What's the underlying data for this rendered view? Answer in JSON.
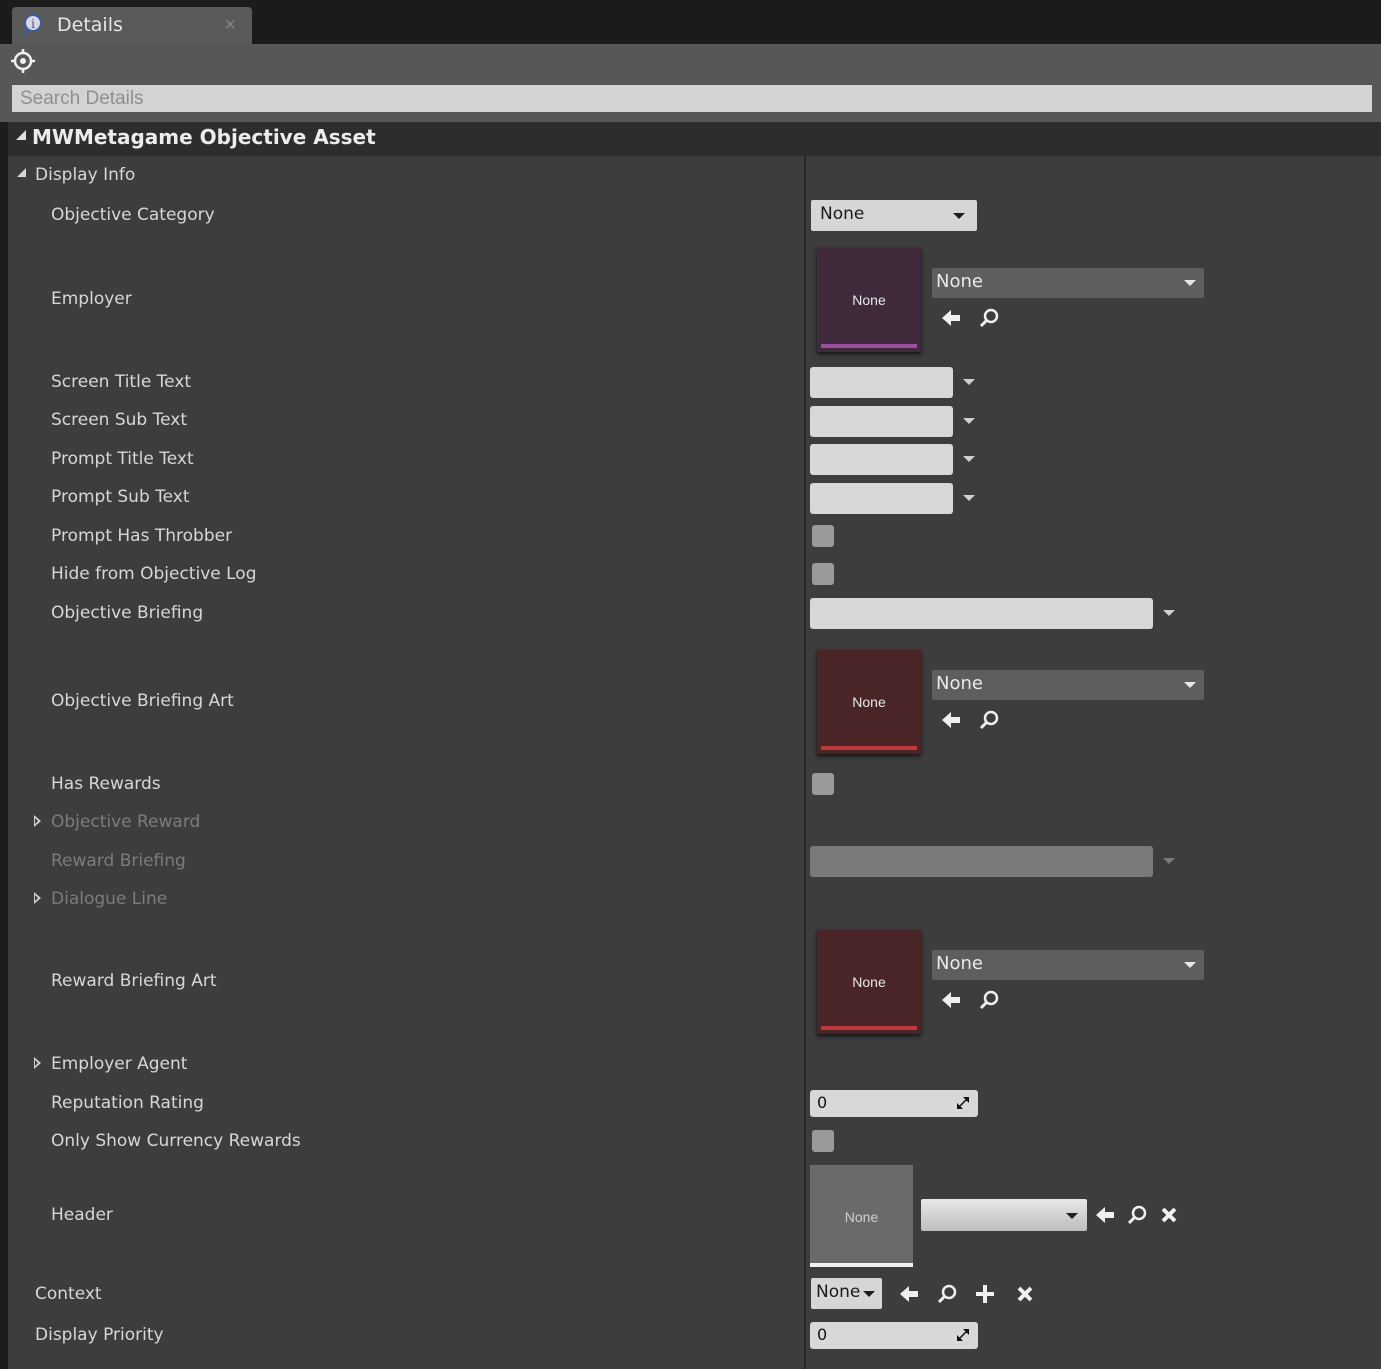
{
  "tab": {
    "label": "Details",
    "close": "×"
  },
  "search": {
    "placeholder": "Search Details"
  },
  "category": {
    "title": "MWMetagame Objective Asset"
  },
  "group": {
    "label": "Display Info"
  },
  "rows": {
    "objective_category": "Objective Category",
    "employer": "Employer",
    "screen_title_text": "Screen Title Text",
    "screen_sub_text": "Screen Sub Text",
    "prompt_title_text": "Prompt Title Text",
    "prompt_sub_text": "Prompt Sub Text",
    "prompt_has_throbber": "Prompt Has Throbber",
    "hide_from_log": "Hide from Objective Log",
    "objective_briefing": "Objective Briefing",
    "objective_briefing_art": "Objective Briefing Art",
    "has_rewards": "Has Rewards",
    "objective_reward": "Objective Reward",
    "reward_briefing": "Reward Briefing",
    "dialogue_line": "Dialogue Line",
    "reward_briefing_art": "Reward Briefing Art",
    "employer_agent": "Employer Agent",
    "reputation_rating": "Reputation Rating",
    "only_show_currency": "Only Show Currency Rewards",
    "header": "Header",
    "context": "Context",
    "display_priority": "Display Priority"
  },
  "values": {
    "objective_category": "None",
    "employer_thumb": "None",
    "employer_asset": "None",
    "briefing_art_thumb": "None",
    "briefing_art_asset": "None",
    "reward_art_thumb": "None",
    "reward_art_asset": "None",
    "reputation_rating": "0",
    "header_thumb": "None",
    "context": "None",
    "display_priority": "0"
  },
  "checkboxes": {
    "prompt_has_throbber": false,
    "hide_from_log": false,
    "has_rewards": false,
    "only_show_currency": false
  },
  "colors": {
    "employer_thumb_bg": "#3f2a3c",
    "employer_thumb_bar": "#9b4fa0",
    "art_thumb_bg": "#4a2527",
    "art_thumb_bar": "#c0393b",
    "header_thumb_bg": "#6a6a6a",
    "header_thumb_bar": "#f2f2f2"
  },
  "icons": [
    "details-icon",
    "lock-target-icon",
    "use-selected-arrow-icon",
    "browse-search-icon",
    "clear-x-icon",
    "add-plus-icon",
    "spin-arrows-icon"
  ]
}
